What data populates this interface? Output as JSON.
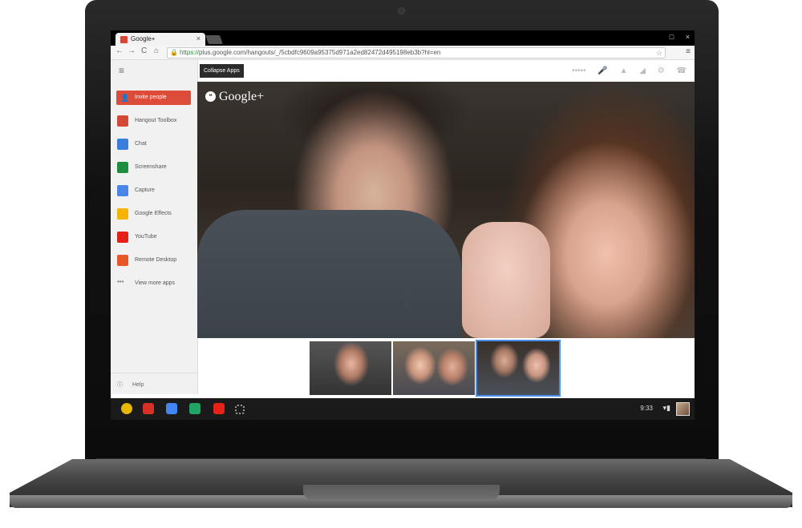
{
  "browser": {
    "tab_title": "Google+",
    "tab_close": "×",
    "window_controls": [
      "□",
      "×"
    ],
    "url_scheme": "https://",
    "url_rest": "plus.google.com/hangouts/_/5cbdfc9609a95375d971a2ed82472d495198eb3b?hl=en",
    "nav_back": "←",
    "nav_forward": "→",
    "nav_reload": "C",
    "nav_home": "⌂"
  },
  "hangout": {
    "tooltip": "Collapse Apps",
    "brand": "Google+",
    "invite_label": "Invite people",
    "apps": [
      {
        "label": "Hangout Toolbox",
        "color": "#d34836"
      },
      {
        "label": "Chat",
        "color": "#3b7ddd"
      },
      {
        "label": "Screenshare",
        "color": "#1e8e3e"
      },
      {
        "label": "Capture",
        "color": "#4a86e8"
      },
      {
        "label": "Google Effects",
        "color": "#f4b400"
      },
      {
        "label": "YouTube",
        "color": "#e62117"
      },
      {
        "label": "Remote Desktop",
        "color": "#e8572a"
      },
      {
        "label": "View more apps",
        "color": "#777777"
      }
    ],
    "help_label": "Help"
  },
  "shelf": {
    "clock": "9:33",
    "apps": [
      {
        "name": "chrome",
        "color": "#e8b800"
      },
      {
        "name": "gmail",
        "color": "#d93025"
      },
      {
        "name": "google-search",
        "color": "#4285f4"
      },
      {
        "name": "drive",
        "color": "#1fa463"
      },
      {
        "name": "youtube",
        "color": "#e62117"
      },
      {
        "name": "app-launcher",
        "color": "#9a9a9a"
      }
    ]
  }
}
